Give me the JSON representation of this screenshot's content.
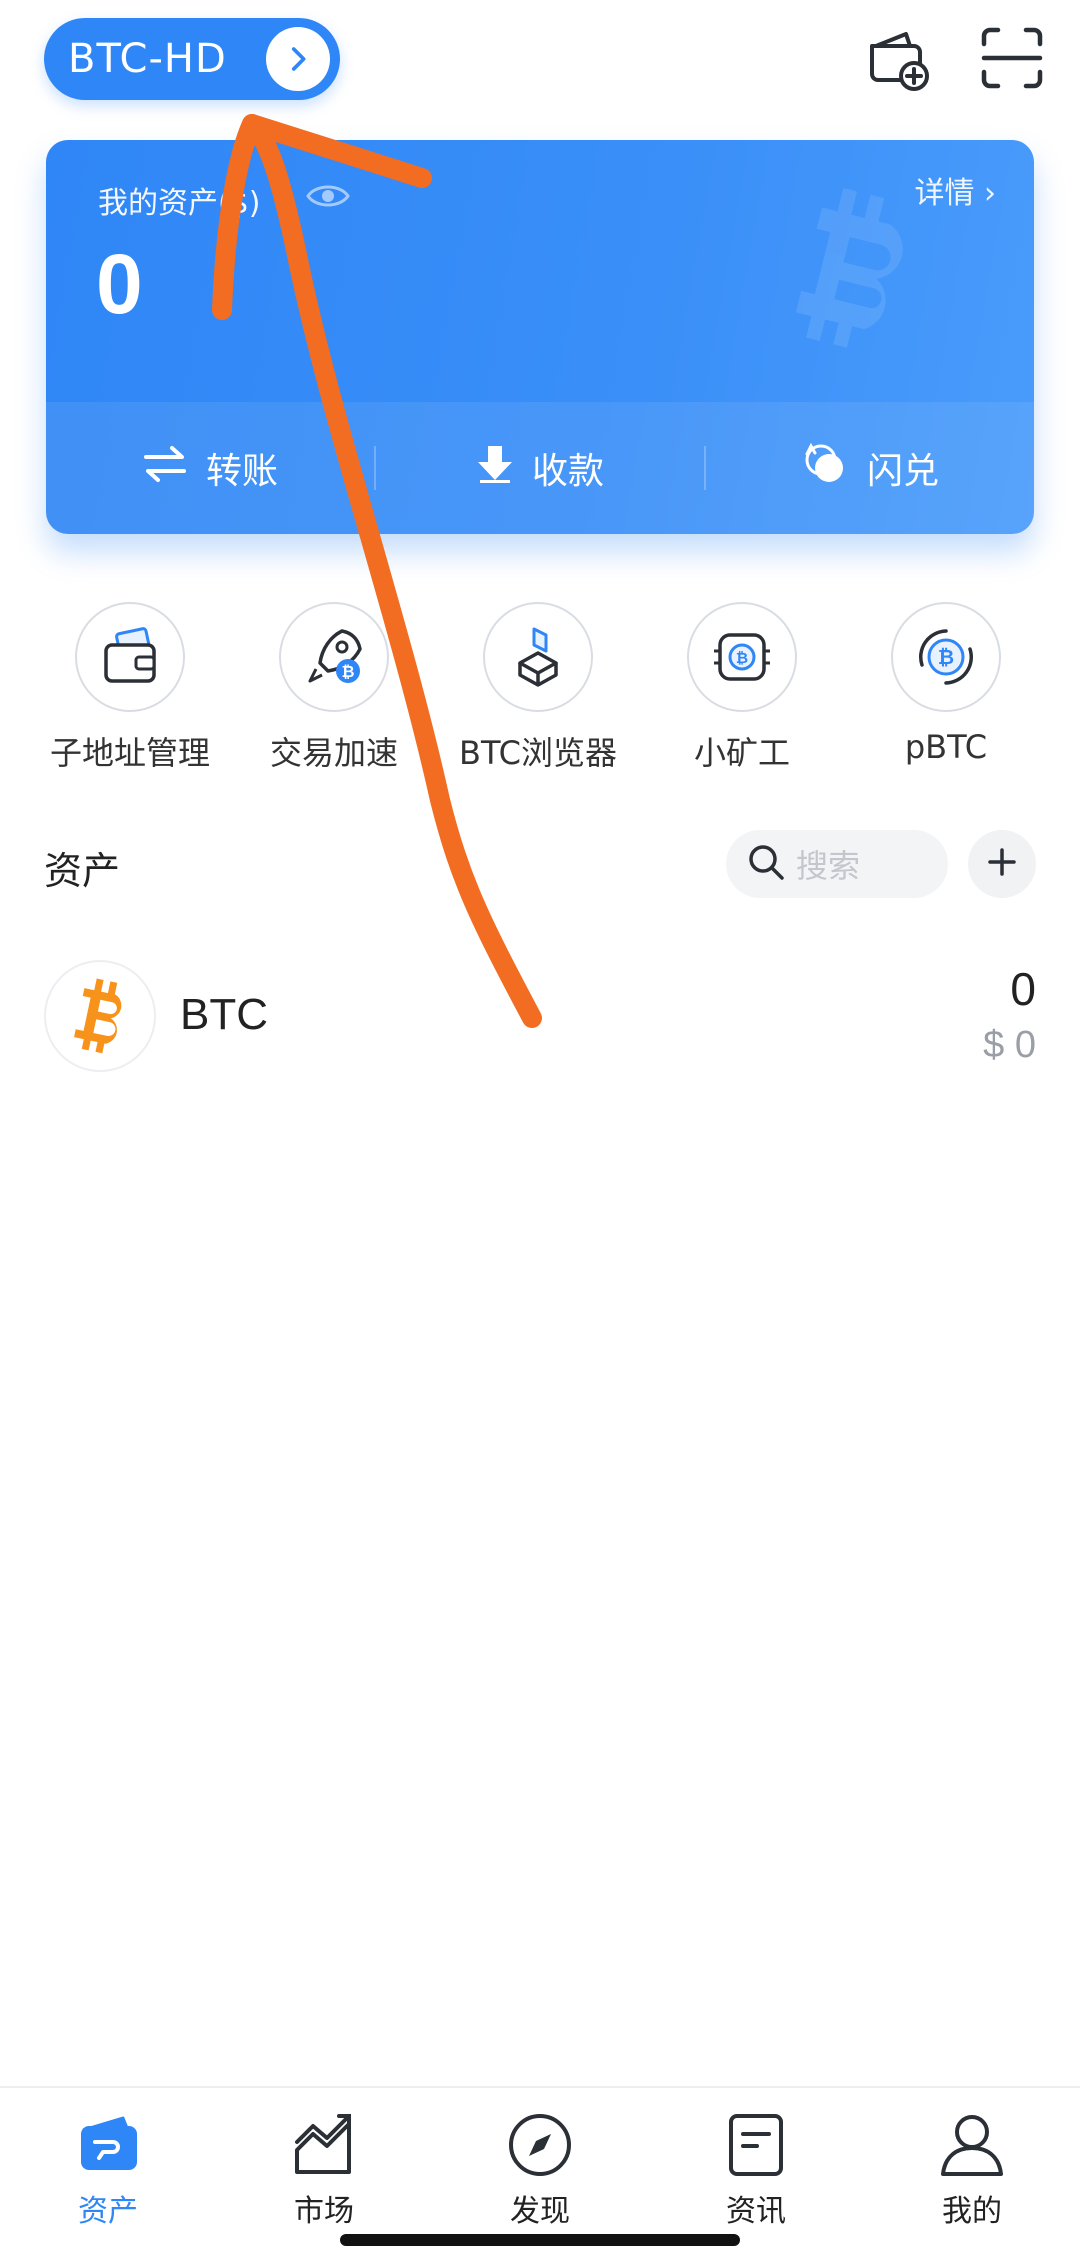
{
  "header": {
    "wallet_name": "BTC-HD",
    "icons": [
      "chevron-right-icon",
      "add-wallet-icon",
      "scan-icon"
    ]
  },
  "asset_card": {
    "label": "我的资产($)",
    "amount": "0",
    "details_label": "详情 ›",
    "actions": [
      {
        "label": "转账",
        "icon": "transfer-icon"
      },
      {
        "label": "收款",
        "icon": "receive-icon"
      },
      {
        "label": "闪兑",
        "icon": "swap-icon"
      }
    ]
  },
  "shortcuts": [
    {
      "label": "子地址管理",
      "icon": "wallet-address-icon"
    },
    {
      "label": "交易加速",
      "icon": "rocket-icon"
    },
    {
      "label": "BTC浏览器",
      "icon": "browser-cube-icon"
    },
    {
      "label": "小矿工",
      "icon": "miner-chip-icon"
    },
    {
      "label": "pBTC",
      "icon": "pbtc-icon"
    }
  ],
  "assets_section": {
    "title": "资产",
    "search_placeholder": "搜索",
    "rows": [
      {
        "symbol": "BTC",
        "quantity": "0",
        "fiat_value": "$ 0"
      }
    ]
  },
  "bottom_nav": [
    {
      "label": "资产",
      "icon": "assets-icon",
      "active": true
    },
    {
      "label": "市场",
      "icon": "market-chart-icon",
      "active": false
    },
    {
      "label": "发现",
      "icon": "compass-icon",
      "active": false
    },
    {
      "label": "资讯",
      "icon": "news-icon",
      "active": false
    },
    {
      "label": "我的",
      "icon": "profile-icon",
      "active": false
    }
  ],
  "colors": {
    "accent": "#2f86f6",
    "annotation": "#f26d21",
    "bitcoin_orange": "#f7931a"
  }
}
